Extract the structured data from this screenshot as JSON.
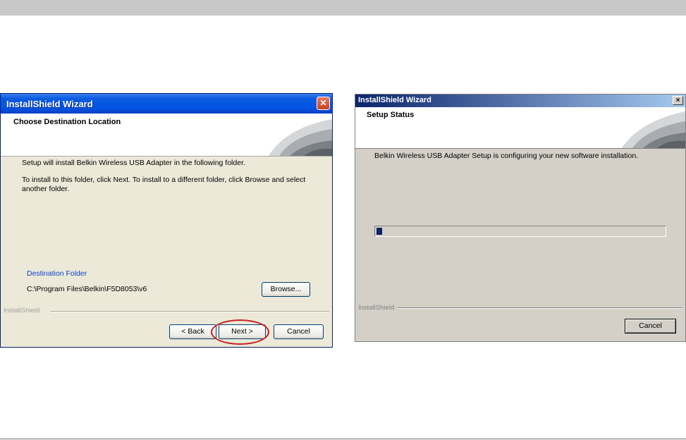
{
  "left_window": {
    "title": "InstallShield Wizard",
    "header_title": "Choose Destination Location",
    "line1": "Setup will install Belkin Wireless USB Adapter in the following folder.",
    "line2": "To install to this folder, click Next. To install to a different folder, click Browse and select another folder.",
    "destination_label": "Destination Folder",
    "destination_path": "C:\\Program Files\\Belkin\\F5D8053\\v6",
    "browse_label": "Browse...",
    "brand_label": "InstallShield",
    "back_label": "< Back",
    "next_label": "Next >",
    "cancel_label": "Cancel",
    "close_glyph": "✕",
    "highlight_color": "#c81e24"
  },
  "right_window": {
    "title": "InstallShield Wizard",
    "header_title": "Setup Status",
    "status_line": "Belkin Wireless USB Adapter Setup is configuring your new software installation.",
    "progress_percent": 2,
    "brand_label": "InstallShield",
    "cancel_label": "Cancel",
    "close_glyph": "×"
  }
}
